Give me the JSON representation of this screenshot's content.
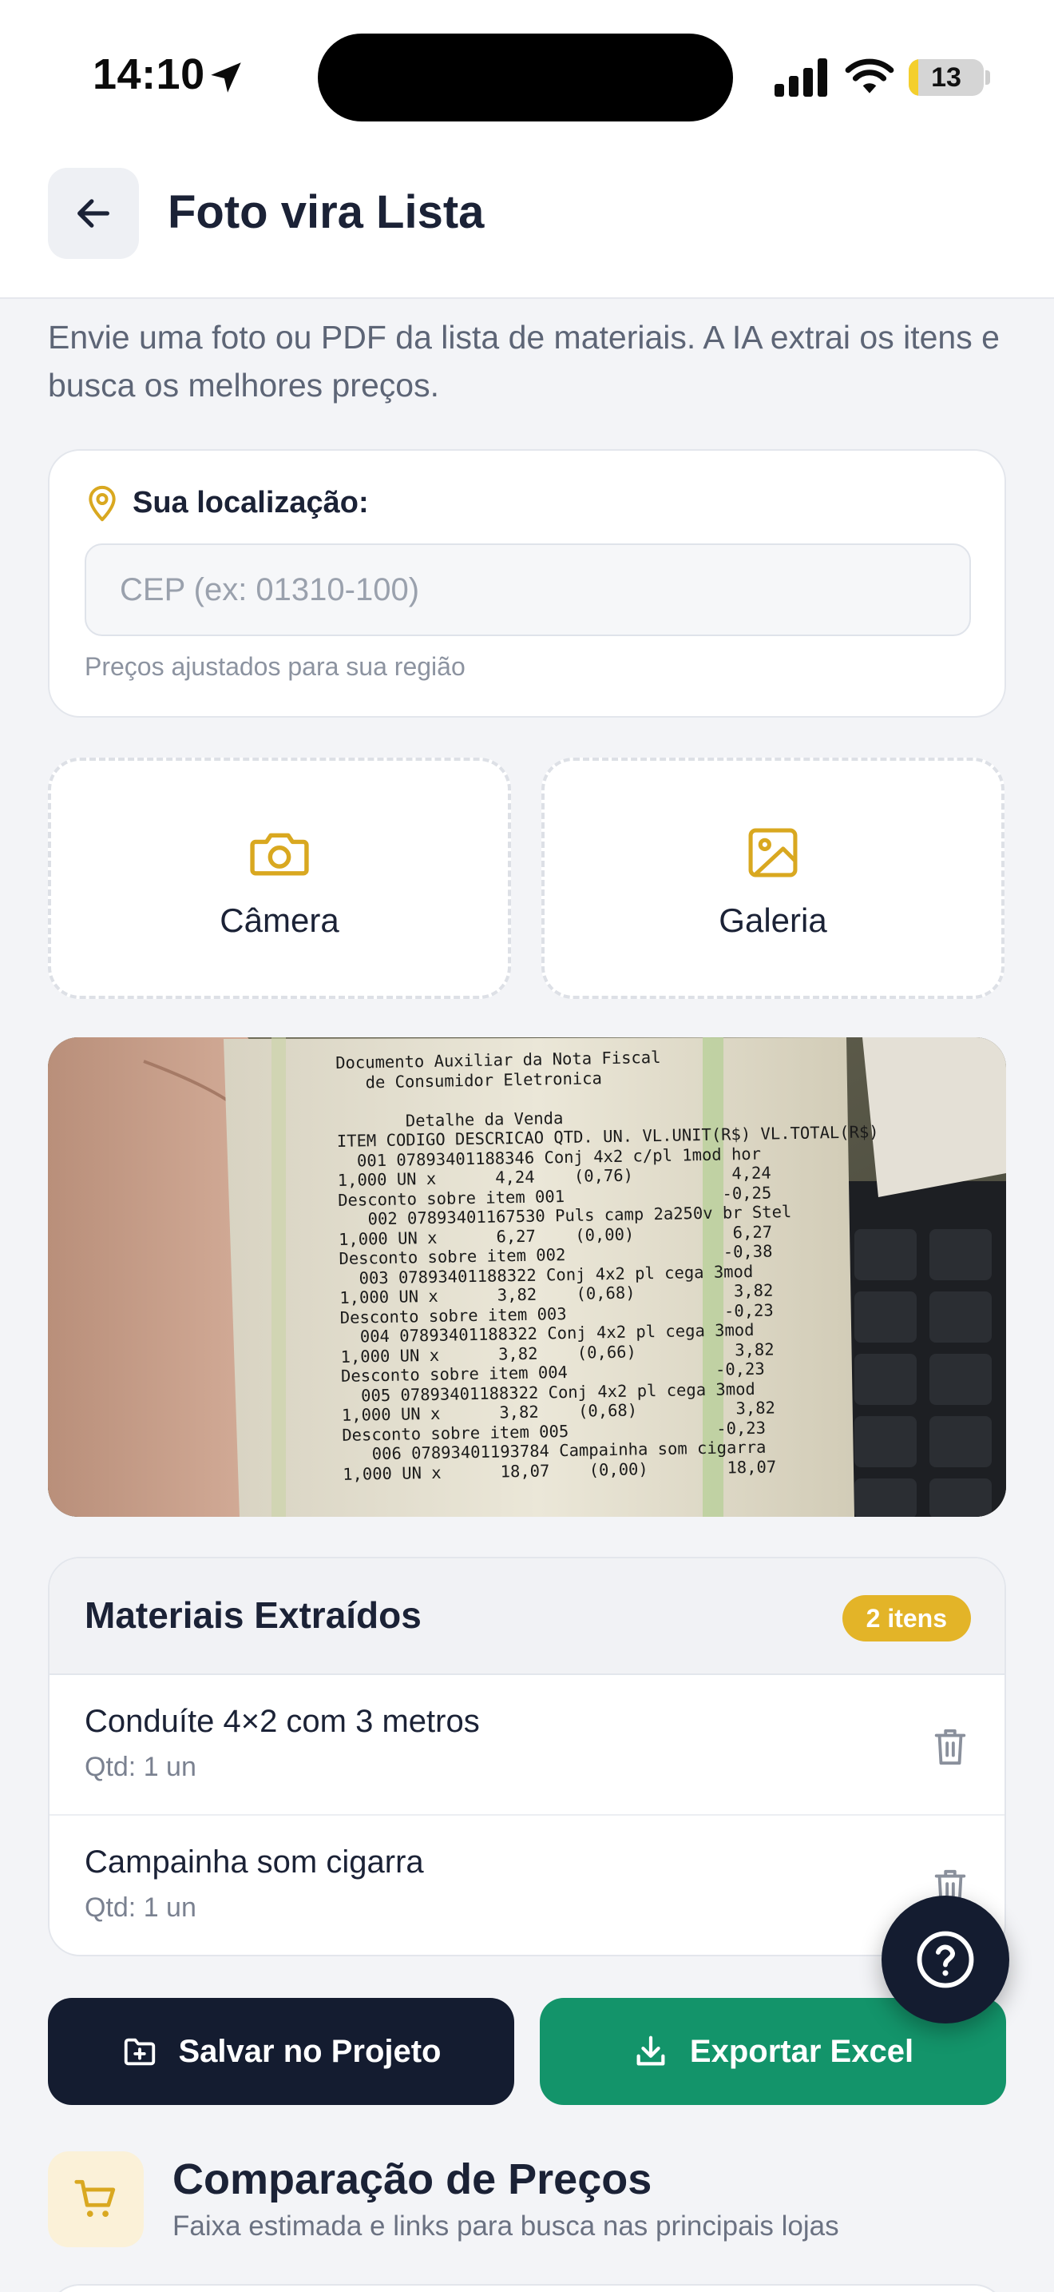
{
  "status_bar": {
    "time": "14:10",
    "battery": "13",
    "battery_level": 0.13,
    "icons": [
      "location-arrow-icon",
      "cellular-signal-icon",
      "wifi-icon",
      "battery-icon"
    ]
  },
  "header": {
    "title": "Foto vira Lista",
    "back_icon": "arrow-left-icon"
  },
  "intro": "Envie uma foto ou PDF da lista de materiais. A IA extrai os itens e busca os melhores preços.",
  "location": {
    "label": "Sua localização:",
    "icon": "map-pin-icon",
    "input_value": "",
    "placeholder": "CEP (ex: 01310-100)",
    "hint": "Preços ajustados para sua região"
  },
  "upload": {
    "camera_label": "Câmera",
    "camera_icon": "camera-icon",
    "gallery_label": "Galeria",
    "gallery_icon": "image-icon"
  },
  "receipt_photo": {
    "text": "Documento Auxiliar da Nota Fiscal\n   de Consumidor Eletronica\n\n       Detalhe da Venda\nITEM CODIGO DESCRICAO QTD. UN. VL.UNIT(R$) VL.TOTAL(R$)\n  001 07893401188346 Conj 4x2 c/pl 1mod hor\n1,000 UN x      4,24    (0,76)          4,24\nDesconto sobre item 001                -0,25\n   002 07893401167530 Puls camp 2a250v br Stel\n1,000 UN x      6,27    (0,00)          6,27\nDesconto sobre item 002                -0,38\n  003 07893401188322 Conj 4x2 pl cega 3mod\n1,000 UN x      3,82    (0,68)          3,82\nDesconto sobre item 003                -0,23\n  004 07893401188322 Conj 4x2 pl cega 3mod\n1,000 UN x      3,82    (0,66)          3,82\nDesconto sobre item 004               -0,23\n  005 07893401188322 Conj 4x2 pl cega 3mod\n1,000 UN x      3,82    (0,68)          3,82\nDesconto sobre item 005               -0,23\n   006 07893401193784 Campainha som cigarra\n1,000 UN x      18,07    (0,00)        18,07"
  },
  "materials": {
    "title": "Materiais Extraídos",
    "count_badge": "2 itens",
    "items": [
      {
        "name": "Conduíte 4×2 com 3 metros",
        "qty": "Qtd: 1 un"
      },
      {
        "name": "Campainha som cigarra",
        "qty": "Qtd: 1 un"
      }
    ],
    "delete_icon": "trash-icon"
  },
  "help_icon": "help-circle-icon",
  "actions": {
    "save_label": "Salvar no Projeto",
    "save_icon": "folder-plus-icon",
    "export_label": "Exportar Excel",
    "export_icon": "download-icon"
  },
  "comparison": {
    "title": "Comparação de Preços",
    "subtitle": "Faixa estimada e links para busca nas principais lojas",
    "icon": "cart-icon"
  },
  "colors": {
    "accent_yellow": "#E3B428",
    "navy": "#141C30",
    "green": "#13946A",
    "background": "#F3F4F7"
  }
}
